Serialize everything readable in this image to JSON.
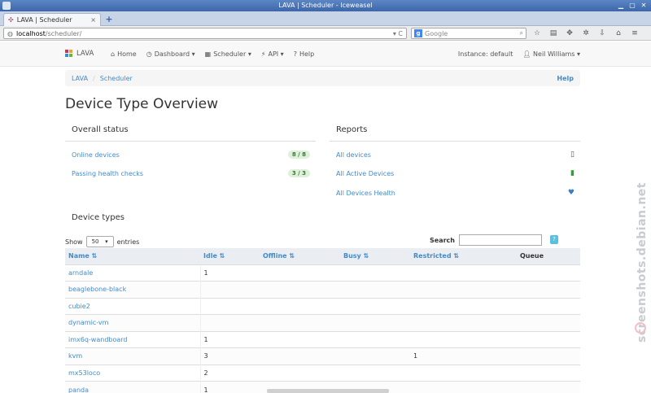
{
  "window": {
    "title": "LAVA | Scheduler - Iceweasel"
  },
  "tab": {
    "label": "LAVA | Scheduler",
    "close": "×",
    "new_tab": "+"
  },
  "urlbar": {
    "host": "localhost",
    "path": "/scheduler/",
    "controls": "▾ C"
  },
  "searchbar": {
    "engine": "g",
    "placeholder": "Google"
  },
  "app": {
    "brand": "LAVA",
    "nav": [
      {
        "label": "Home",
        "icon": "home-icon"
      },
      {
        "label": "Dashboard",
        "icon": "dashboard-icon",
        "dropdown": true
      },
      {
        "label": "Scheduler",
        "icon": "scheduler-icon",
        "dropdown": true
      },
      {
        "label": "API",
        "icon": "api-icon",
        "dropdown": true
      },
      {
        "label": "Help",
        "icon": "help-icon"
      }
    ],
    "instance": "Instance: default",
    "user": "Neil Williams"
  },
  "breadcrumb": {
    "items": [
      "LAVA",
      "Scheduler"
    ],
    "help": "Help"
  },
  "page_title": "Device Type Overview",
  "overall_status": {
    "heading": "Overall status",
    "rows": [
      {
        "label": "Online devices",
        "badge": "8 / 8"
      },
      {
        "label": "Passing health checks",
        "badge": "3 / 3"
      }
    ]
  },
  "reports": {
    "heading": "Reports",
    "rows": [
      {
        "label": "All devices",
        "icon": "phone-icon"
      },
      {
        "label": "All Active Devices",
        "icon": "phone-active-icon"
      },
      {
        "label": "All Devices Health",
        "icon": "heart-icon"
      }
    ]
  },
  "device_types": {
    "heading": "Device types",
    "show_label": "Show",
    "entries_value": "50",
    "entries_label": "entries",
    "search_label": "Search",
    "help_btn": "?",
    "columns": [
      "Name",
      "Idle",
      "Offline",
      "Busy",
      "Restricted",
      "Queue"
    ],
    "sort_marker": "⇅",
    "rows": [
      {
        "name": "arndale",
        "idle": "1",
        "offline": "",
        "busy": "",
        "restricted": "",
        "queue": ""
      },
      {
        "name": "beaglebone-black",
        "idle": "",
        "offline": "",
        "busy": "",
        "restricted": "",
        "queue": ""
      },
      {
        "name": "cubie2",
        "idle": "",
        "offline": "",
        "busy": "",
        "restricted": "",
        "queue": ""
      },
      {
        "name": "dynamic-vm",
        "idle": "",
        "offline": "",
        "busy": "",
        "restricted": "",
        "queue": ""
      },
      {
        "name": "imx6q-wandboard",
        "idle": "1",
        "offline": "",
        "busy": "",
        "restricted": "",
        "queue": ""
      },
      {
        "name": "kvm",
        "idle": "3",
        "offline": "",
        "busy": "",
        "restricted": "1",
        "queue": ""
      },
      {
        "name": "mx53loco",
        "idle": "2",
        "offline": "",
        "busy": "",
        "restricted": "",
        "queue": ""
      },
      {
        "name": "panda",
        "idle": "1",
        "offline": "",
        "busy": "",
        "restricted": "",
        "queue": ""
      }
    ]
  },
  "watermark": "screenshots.debian.net",
  "colors": {
    "link": "#428bca",
    "badge_bg": "#dff0d8",
    "badge_fg": "#3c763d",
    "titlebar": "#4a74b6"
  }
}
